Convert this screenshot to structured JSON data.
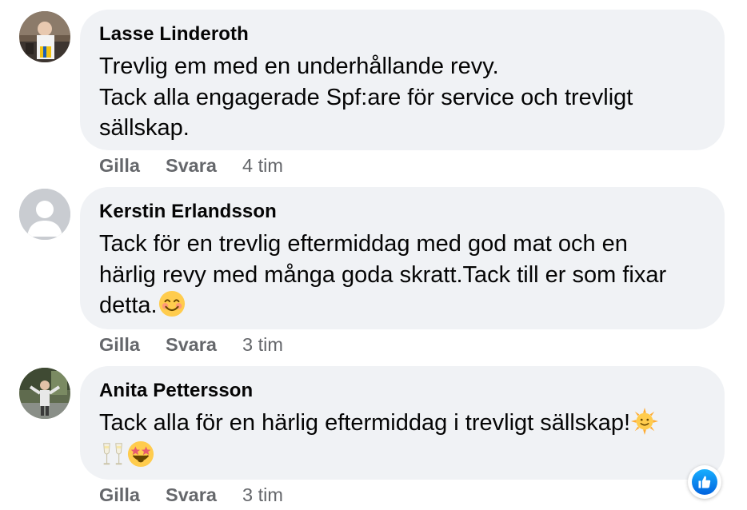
{
  "comments": [
    {
      "author": "Lasse Linderoth",
      "lines": [
        "Trevlig em med en underhållande revy.",
        "Tack alla engagerade Spf:are för service och trevligt",
        "sällskap."
      ],
      "like_label": "Gilla",
      "reply_label": "Svara",
      "time": "4 tim"
    },
    {
      "author": "Kerstin Erlandsson",
      "lines": [
        "Tack för en trevlig eftermiddag med god mat och en",
        "härlig revy med många goda skratt.Tack till er som fixar",
        "detta."
      ],
      "emoji_line3": "smiling-face-emoji",
      "like_label": "Gilla",
      "reply_label": "Svara",
      "time": "3 tim"
    },
    {
      "author": "Anita Pettersson",
      "lines": [
        "Tack alla för en härlig eftermiddag i trevligt sällskap!"
      ],
      "emoji_line1": "sun-with-face-emoji",
      "emoji_line2": [
        "champagne-glasses-emoji",
        "star-struck-emoji"
      ],
      "like_label": "Gilla",
      "reply_label": "Svara",
      "time": "3 tim",
      "reaction": "like-reaction-icon"
    }
  ],
  "colors": {
    "bubble_bg": "#f0f2f5",
    "meta_text": "#65676b",
    "text": "#050505",
    "like_blue": "#1877f2"
  }
}
